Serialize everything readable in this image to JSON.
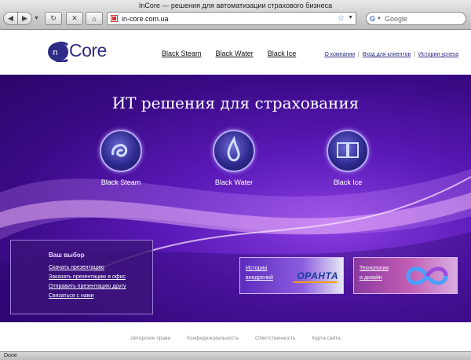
{
  "window": {
    "title": "InCore — решения для автоматизации страхового бизнеса"
  },
  "toolbar": {
    "back_icon": "back-arrow-icon",
    "forward_icon": "forward-arrow-icon",
    "reload_icon": "reload-icon",
    "stop_icon": "stop-icon",
    "home_icon": "home-icon",
    "url": "in-core.com.ua",
    "search_placeholder": "Google"
  },
  "header": {
    "logo_text": "Core",
    "logo_prefix": "in",
    "nav": [
      "Black Steam",
      "Black Water",
      "Black Ice"
    ],
    "top_links": [
      "О компании",
      "Вход для клиентов",
      "Истории успеха"
    ]
  },
  "hero": {
    "title": "ИТ решения для страхования",
    "products": [
      {
        "label": "Black Steam",
        "icon": "steam-orb-icon"
      },
      {
        "label": "Black Water",
        "icon": "water-drop-icon"
      },
      {
        "label": "Black Ice",
        "icon": "ice-book-icon"
      }
    ]
  },
  "choice": {
    "title": "Ваш выбор",
    "links": [
      "Скачать презентацию",
      "Заказать презентацию в офис",
      "Отправить презентацию другу",
      "Связаться с нами"
    ]
  },
  "promos": {
    "stories": {
      "line1": "Истории",
      "line2": "внедрений",
      "brand": "ОРАНТА"
    },
    "tech": {
      "line1": "Технологии",
      "line2": "и дизайн"
    }
  },
  "footer": {
    "links": [
      "Авторские права",
      "Конфиденциальность",
      "Ответственность",
      "Карта сайта"
    ]
  },
  "status": {
    "text": "Done"
  },
  "colors": {
    "hero_purple": "#4a12a0",
    "logo_blue": "#2f2b86",
    "accent_violet": "#b7a8ff"
  }
}
